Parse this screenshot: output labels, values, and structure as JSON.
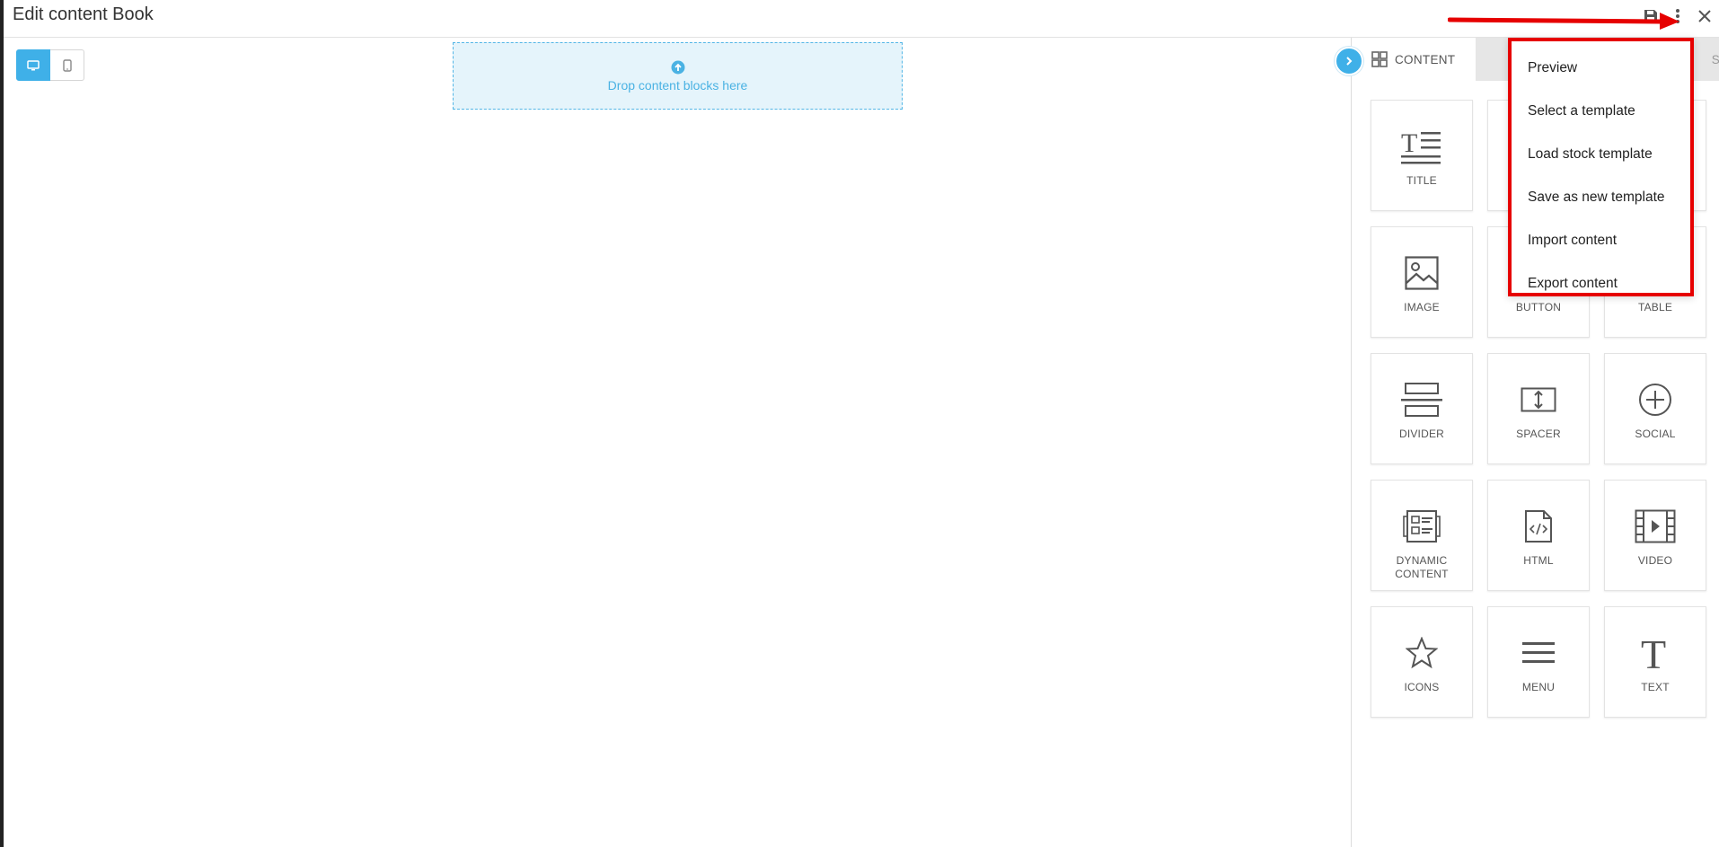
{
  "header": {
    "title": "Edit content Book",
    "icons": [
      "save-icon",
      "more-vertical-icon",
      "close-icon"
    ]
  },
  "device_toggle": {
    "icons": [
      "desktop-icon",
      "mobile-icon"
    ],
    "selected": "desktop"
  },
  "canvas": {
    "drop_text": "Drop content blocks here"
  },
  "panel": {
    "tabs": [
      {
        "label": "CONTENT"
      },
      {
        "label": ""
      },
      {
        "label": "S"
      }
    ],
    "tiles": [
      {
        "label": "TITLE",
        "icon": "title-icon"
      },
      {
        "label": "",
        "icon": "paragraph-icon"
      },
      {
        "label": "",
        "icon": "list-icon"
      },
      {
        "label": "IMAGE",
        "icon": "image-icon"
      },
      {
        "label": "BUTTON",
        "icon": "button-icon"
      },
      {
        "label": "TABLE",
        "icon": "table-icon"
      },
      {
        "label": "DIVIDER",
        "icon": "divider-icon"
      },
      {
        "label": "SPACER",
        "icon": "spacer-icon"
      },
      {
        "label": "SOCIAL",
        "icon": "social-icon"
      },
      {
        "label": "DYNAMIC CONTENT",
        "icon": "dynamic-content-icon"
      },
      {
        "label": "HTML",
        "icon": "html-icon"
      },
      {
        "label": "VIDEO",
        "icon": "video-icon"
      },
      {
        "label": "ICONS",
        "icon": "star-icon"
      },
      {
        "label": "MENU",
        "icon": "menu-icon"
      },
      {
        "label": "TEXT",
        "icon": "text-icon"
      }
    ]
  },
  "dropdown": {
    "items": [
      {
        "label": "Preview"
      },
      {
        "label": "Select a template"
      },
      {
        "label": "Load stock template"
      },
      {
        "label": "Save as new template"
      },
      {
        "label": "Import content"
      },
      {
        "label": "Export content"
      }
    ]
  },
  "colors": {
    "accent": "#3fb0e8",
    "highlight": "#e60000"
  }
}
